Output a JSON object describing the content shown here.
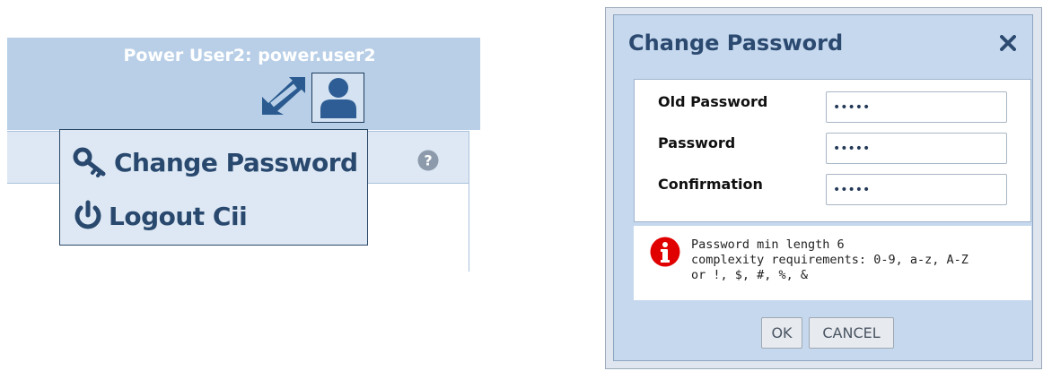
{
  "user_menu": {
    "user_title": "Power User2: power.user2",
    "icons": {
      "expand": "expand-arrows-icon",
      "user": "user-icon",
      "help": "question-circle-icon",
      "change_password": "key-icon",
      "logout": "power-icon"
    },
    "items": [
      {
        "label": "Change Password"
      },
      {
        "label": "Logout Cii"
      }
    ]
  },
  "dialog": {
    "title": "Change Password",
    "close_icon": "close-x-icon",
    "fields": [
      {
        "label": "Old Password",
        "value": "•••••"
      },
      {
        "label": "Password",
        "value": "•••••"
      },
      {
        "label": "Confirmation",
        "value": "•••••"
      }
    ],
    "info": {
      "icon": "info-circle-icon",
      "lines": [
        "Password min length 6",
        "complexity requirements: 0-9, a-z, A-Z",
        "or !, $, #, %, &"
      ]
    },
    "buttons": {
      "ok": "OK",
      "cancel": "CANCEL"
    }
  },
  "colors": {
    "header_bg": "#b8cfe7",
    "menu_text": "#29486e",
    "dialog_bg": "#c5d8ee",
    "info_red": "#e00000"
  }
}
